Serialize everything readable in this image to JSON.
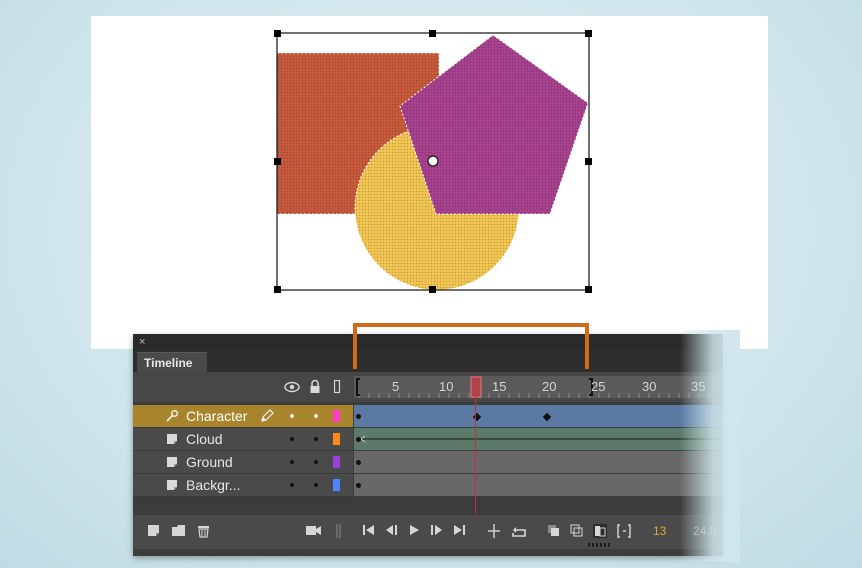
{
  "panel": {
    "tab_label": "Timeline",
    "close_glyph": "×"
  },
  "ruler": {
    "ticks": [
      "5",
      "10",
      "15",
      "20",
      "25",
      "30",
      "35"
    ]
  },
  "layers": [
    {
      "name": "Character",
      "selected": true,
      "color": "#ff3fbf"
    },
    {
      "name": "Cloud",
      "selected": false,
      "color": "#ff8a1a"
    },
    {
      "name": "Ground",
      "selected": false,
      "color": "#9b3fd6"
    },
    {
      "name": "Backgr...",
      "selected": false,
      "color": "#4f84ff"
    }
  ],
  "bottom_bar": {
    "current_frame": "13",
    "fps": "24.0"
  },
  "colors": {
    "callout": "#d16a1a",
    "selected_layer": "#a8842d",
    "square": "#c85a3c",
    "circle": "#f2c653",
    "pentagon": "#a8428f"
  },
  "icons": [
    "eye-icon",
    "lock-icon",
    "outline-icon",
    "pencil-icon",
    "camera-icon"
  ]
}
